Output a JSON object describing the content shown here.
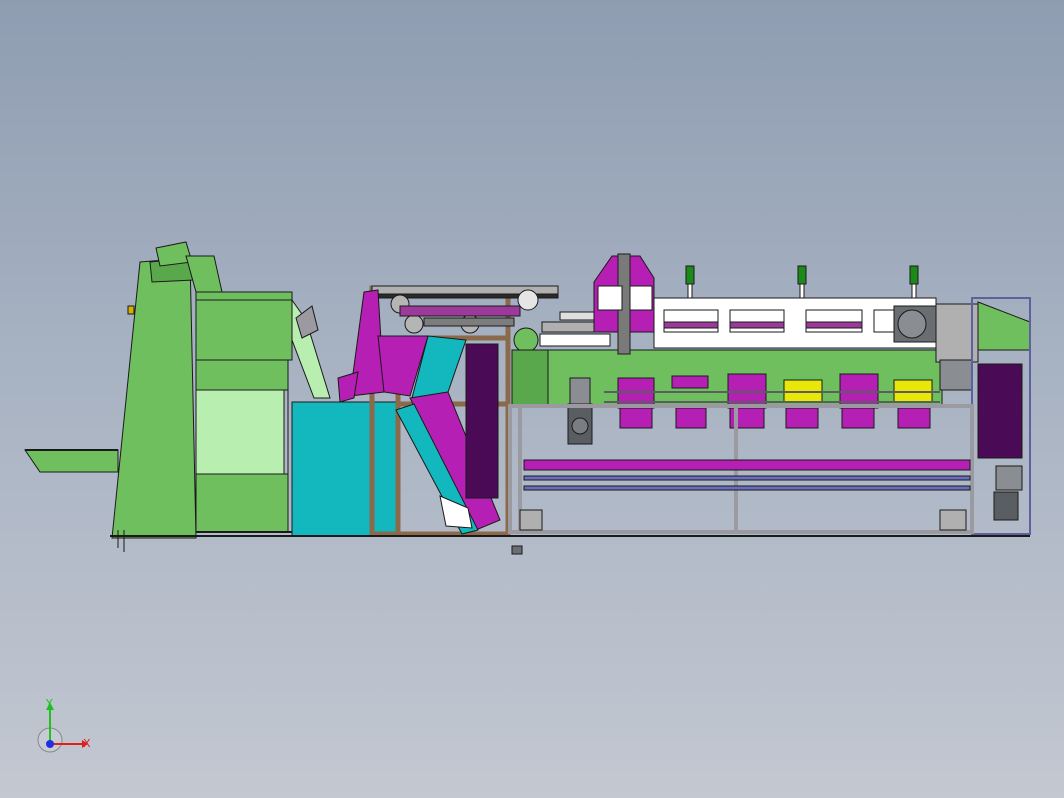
{
  "viewport": {
    "background_top": "#8f9db2",
    "background_bottom": "#c3c8d1"
  },
  "colors": {
    "frame_green": "#6fbf5f",
    "light_green": "#b8efb0",
    "teal_box": "#13b8bf",
    "magenta": "#b61fb4",
    "dark_purple": "#4b0a55",
    "frame_brown": "#8a6a4a",
    "gray_frame": "#9a9aa0",
    "yellow_roller": "#e9e60a",
    "stack_light_green": "#1a8a1a",
    "motor_gray": "#6a6e73",
    "outline": "#1a1a1a"
  },
  "triad": {
    "x_label": "X",
    "y_label": "Y",
    "x_color": "#e02020",
    "y_color": "#20c020",
    "z_color": "#2030e0"
  }
}
